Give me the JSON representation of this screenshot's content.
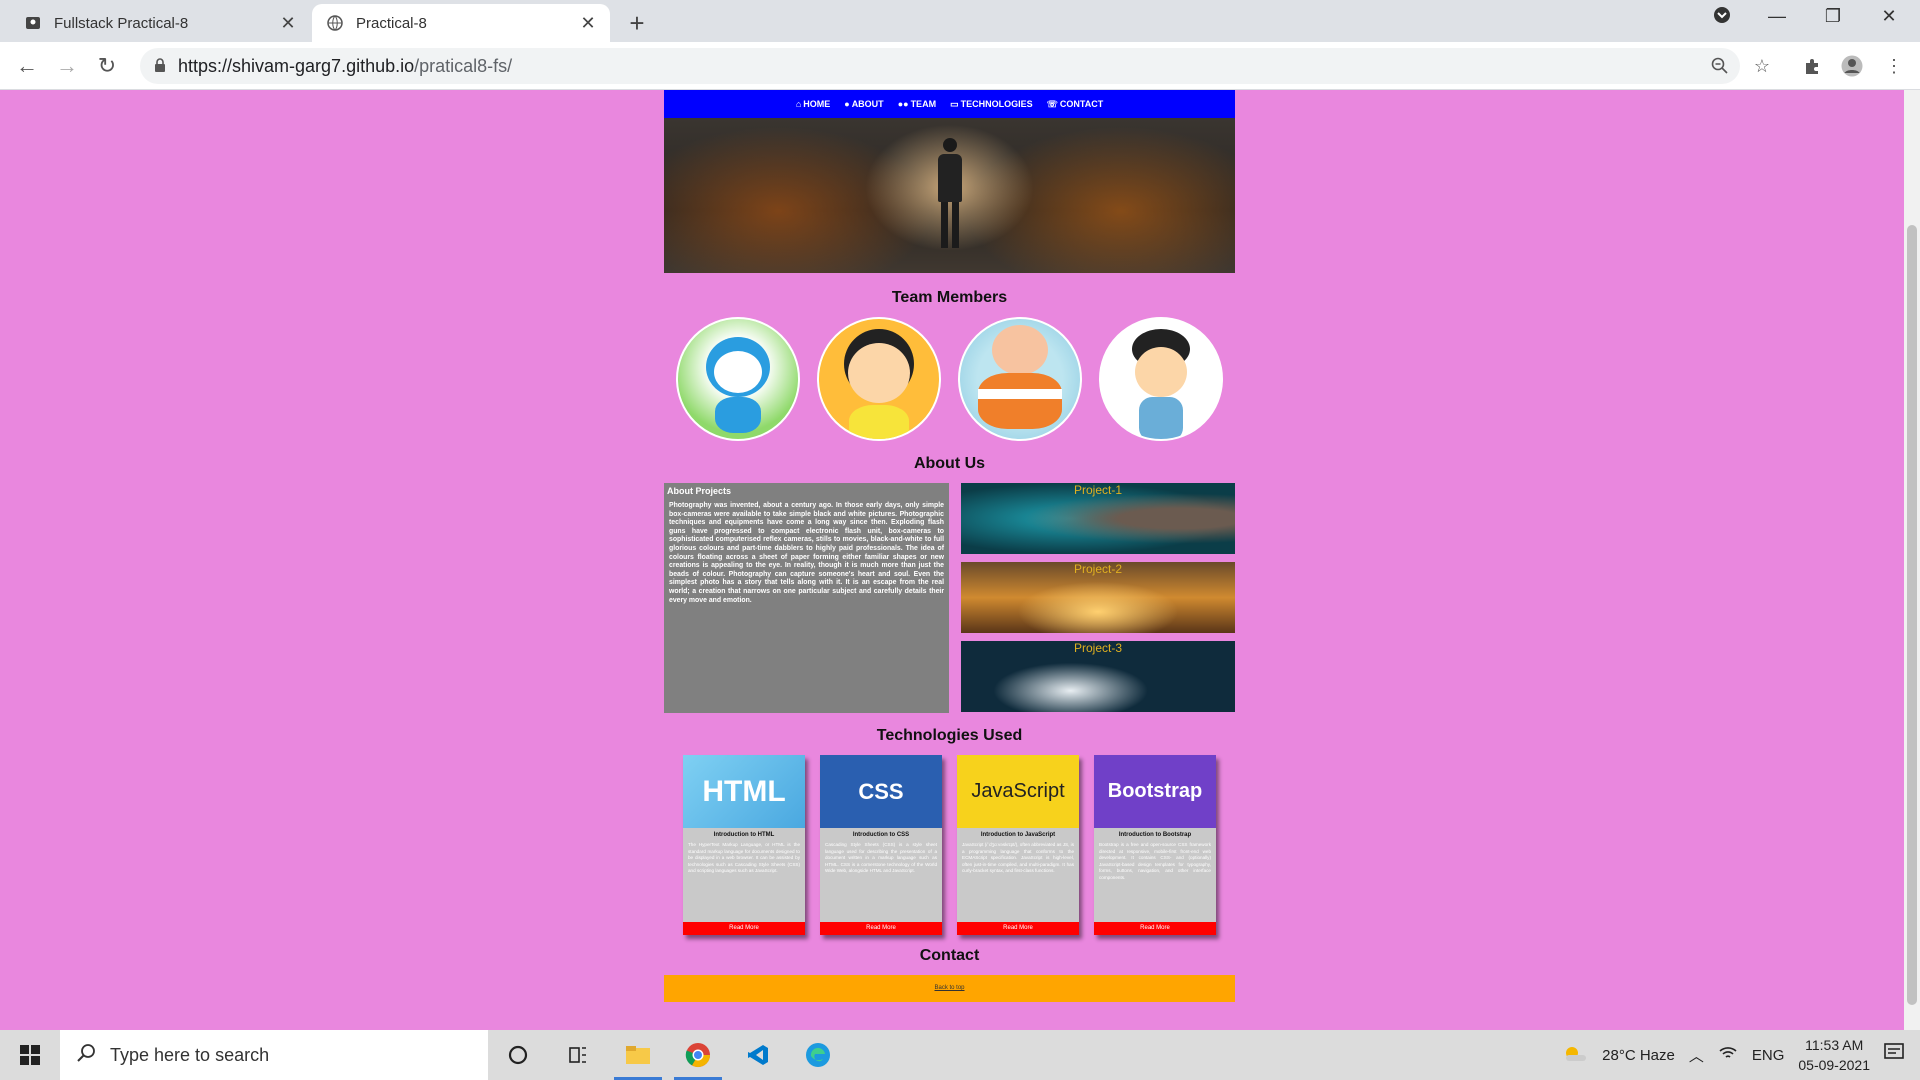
{
  "browser": {
    "tabs": [
      {
        "title": "Fullstack Practical-8",
        "active": false
      },
      {
        "title": "Practical-8",
        "active": true
      }
    ],
    "url_host": "https://shivam-garg7.github.io",
    "url_path": "/pratical8-fs/"
  },
  "page": {
    "nav": [
      {
        "icon": "home-icon",
        "label": "HOME"
      },
      {
        "icon": "user-icon",
        "label": "ABOUT"
      },
      {
        "icon": "users-icon",
        "label": "TEAM"
      },
      {
        "icon": "desktop-icon",
        "label": "TECHNOLOGIES"
      },
      {
        "icon": "phone-icon",
        "label": "CONTACT"
      }
    ],
    "team_title": "Team Members",
    "about_title": "About Us",
    "about_heading": "About Projects",
    "about_text": "Photography was invented, about a century ago. In those early days, only simple box-cameras were available to take simple black and white pictures. Photographic techniques and equipments have come a long way since then. Exploding flash guns have progressed to compact electronic flash unit, box-cameras to sophisticated computerised reflex cameras, stills to movies, black-and-white to full glorious colours and part-time dabblers to highly paid professionals. The idea of colours floating across a sheet of paper forming either familiar shapes or new creations is appealing to the eye. In reality, though it is much more than just the beads of colour. Photography can capture someone's heart and soul. Even the simplest photo has a story that tells along with it. It is an escape from the real world; a creation that narrows on one particular subject and carefully details their every move and emotion.",
    "projects": [
      "Project-1",
      "Project-2",
      "Project-3"
    ],
    "tech_title": "Technologies Used",
    "tech_cards": [
      {
        "image_text": "HTML",
        "title": "Introduction to HTML",
        "text": "The HyperText Markup Language, or HTML is the standard markup language for documents designed to be displayed in a web browser. It can be assisted by technologies such as Cascading Style Sheets (CSS) and scripting languages such as JavaScript.",
        "button": "Read More"
      },
      {
        "image_text": "CSS",
        "title": "Introduction to CSS",
        "text": "Cascading Style Sheets (CSS) is a style sheet language used for describing the presentation of a document written in a markup language such as HTML. CSS is a cornerstone technology of the World Wide Web, alongside HTML and JavaScript.",
        "button": "Read More"
      },
      {
        "image_text": "JavaScript",
        "title": "Introduction to JavaScript",
        "text": "JavaScript (/ˈdʒɑːvəskrɪpt/), often abbreviated as JS, is a programming language that conforms to the ECMAScript specification. JavaScript is high-level, often just-in-time compiled, and multi-paradigm. It has curly-bracket syntax, and first-class functions.",
        "button": "Read More"
      },
      {
        "image_text": "Bootstrap",
        "title": "Introduction to Bootstrap",
        "text": "Bootstrap is a free and open-source CSS framework directed at responsive, mobile-first front-end web development. It contains CSS- and (optionally) JavaScript-based design templates for typography, forms, buttons, navigation, and other interface components.",
        "button": "Read More"
      }
    ],
    "contact_title": "Contact",
    "back_to_top": "Back to top"
  },
  "taskbar": {
    "search_placeholder": "Type here to search",
    "weather": "28°C  Haze",
    "language": "ENG",
    "time": "11:53 AM",
    "date": "05-09-2021"
  }
}
